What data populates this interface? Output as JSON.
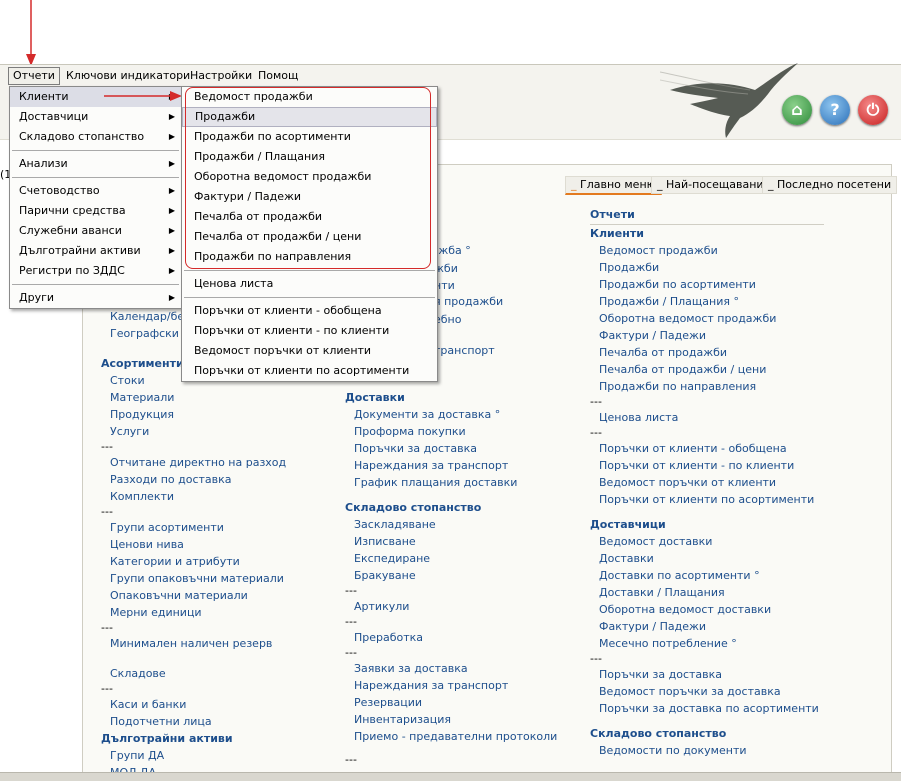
{
  "menubar": {
    "items": [
      "Отчети",
      "Ключови индикатори",
      "Настройки",
      "Помощ"
    ]
  },
  "main_menu": {
    "items": [
      {
        "label": "Клиенти",
        "submenu": true
      },
      {
        "label": "Доставчици",
        "submenu": true
      },
      {
        "label": "Складово стопанство",
        "submenu": true
      },
      {
        "label": "Анализи",
        "submenu": true
      },
      {
        "label": "Счетоводство",
        "submenu": true
      },
      {
        "label": "Парични средства",
        "submenu": true
      },
      {
        "label": "Служебни аванси",
        "submenu": true
      },
      {
        "label": "Дълготрайни активи",
        "submenu": true
      },
      {
        "label": "Регистри по ЗДДС",
        "submenu": true
      },
      {
        "label": "Други",
        "submenu": true
      }
    ]
  },
  "clients_submenu": {
    "items": [
      "Ведомост продажби",
      "Продажби",
      "Продажби по асортименти",
      "Продажби / Плащания",
      "Оборотна ведомост продажби",
      "Фактури / Падежи",
      "Печалба от продажби",
      "Печалба от продажби / цени",
      "Продажби по направления",
      "Ценова листа",
      "Поръчки от клиенти - обобщена",
      "Поръчки от клиенти - по клиенти",
      "Ведомост поръчки от клиенти",
      "Поръчки от клиенти по асортименти"
    ]
  },
  "tabs": [
    "Главно меню",
    "Най-посещавани",
    "Последно посетени"
  ],
  "tab_prefix": "_",
  "icons": {
    "home": "home-icon",
    "help": "help-icon",
    "power": "power-icon",
    "logo": "hummingbird-logo"
  },
  "colors": {
    "link": "#1d4e8c",
    "accent": "#e37a1f",
    "annotation": "#d42a2a"
  },
  "left_partial": {
    "item_left_cut": "(1",
    "calendar": "Календар/бел",
    "geo": "Географски р",
    "behind_1": "дажба °",
    "behind_2": "жби",
    "behind_3": "нти",
    "behind_4": "я продажби",
    "behind_5": "ебно",
    "behind_6": "транспорт"
  },
  "col1": {
    "sec_assort": "Асортименти",
    "assort_items": [
      "Стоки",
      "Материали",
      "Продукция",
      "Услуги"
    ],
    "sep": "---",
    "group2": [
      "Отчитане директно на разход",
      "Разходи по доставка",
      "Комплекти"
    ],
    "group3": [
      "Групи асортименти",
      "Ценови нива",
      "Категории и атрибути",
      "Групи опаковъчни материали",
      "Опаковъчни материали",
      "Мерни единици"
    ],
    "group4": [
      "Минимален наличен резерв"
    ],
    "group5": [
      "Складове"
    ],
    "group6": [
      "Каси и банки",
      "Подотчетни лица"
    ],
    "sec_fixed": "Дълготрайни активи",
    "fixed_items": [
      "Групи ДА",
      "МОЛ ДА"
    ]
  },
  "col2": {
    "sec_deliv": "Доставки",
    "deliv_items": [
      "Документи за доставка °",
      "Проформа покупки",
      "Поръчки за доставка",
      "Нареждания за транспорт",
      "График плащания доставки"
    ],
    "sec_stock": "Складово стопанство",
    "stock_items": [
      "Заскладяване",
      "Изписване",
      "Експедиране",
      "Бракуване"
    ],
    "sep": "---",
    "art": "Артикули",
    "proc": "Преработка",
    "group_last": [
      "Заявки за доставка",
      "Нареждания за транспорт",
      "Резервации",
      "Инвентаризация",
      "Приемо - предавателни протоколи"
    ]
  },
  "col3": {
    "heading": "Отчети",
    "sec_clients": "Клиенти",
    "clients_items": [
      "Ведомост продажби",
      "Продажби",
      "Продажби по асортименти",
      "Продажби / Плащания °",
      "Оборотна ведомост продажби",
      "Фактури / Падежи",
      "Печалба от продажби",
      "Печалба от продажби / цени",
      "Продажби по направления"
    ],
    "sep": "---",
    "price_list": "Ценова листа",
    "orders_items": [
      "Поръчки от клиенти - обобщена",
      "Поръчки от клиенти - по клиенти",
      "Ведомост поръчки от клиенти",
      "Поръчки от клиенти по асортименти"
    ],
    "sec_suppliers": "Доставчици",
    "suppliers_items": [
      "Ведомост доставки",
      "Доставки",
      "Доставки по асортименти °",
      "Доставки / Плащания",
      "Оборотна ведомост доставки",
      "Фактури / Падежи",
      "Месечно потребление °"
    ],
    "supp_orders": [
      "Поръчки за доставка",
      "Ведомост поръчки за доставка",
      "Поръчки за доставка по асортименти"
    ],
    "sec_stock": "Складово стопанство",
    "stock_items": [
      "Ведомости по документи"
    ]
  }
}
